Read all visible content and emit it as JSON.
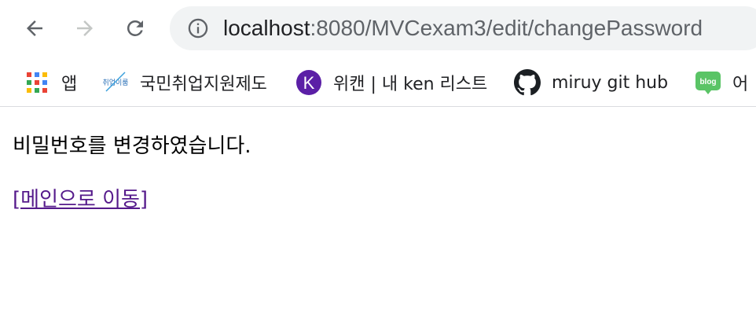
{
  "browser": {
    "url_host": "localhost",
    "url_path": ":8080/MVCexam3/edit/changePassword"
  },
  "bookmarks": [
    {
      "label": "앱",
      "icon": "apps-grid-icon"
    },
    {
      "label": "국민취업지원제도",
      "icon": "employment-logo-icon"
    },
    {
      "label": "위캔 | 내 ken 리스트",
      "icon": "k-logo-icon"
    },
    {
      "label": "miruy git hub",
      "icon": "github-icon"
    },
    {
      "label": "어",
      "icon": "blog-icon"
    }
  ],
  "icon_texts": {
    "employment_logo": "취업이룸",
    "k_logo": "K",
    "blog": "blog"
  },
  "page": {
    "message": "비밀번호를 변경하였습니다.",
    "link": "[메인으로 이동]"
  },
  "colors": {
    "link_visited": "#551a8b",
    "omnibox_bg": "#f1f3f4",
    "k_logo_bg": "#5b1fa6",
    "blog_green": "#5ac466"
  }
}
